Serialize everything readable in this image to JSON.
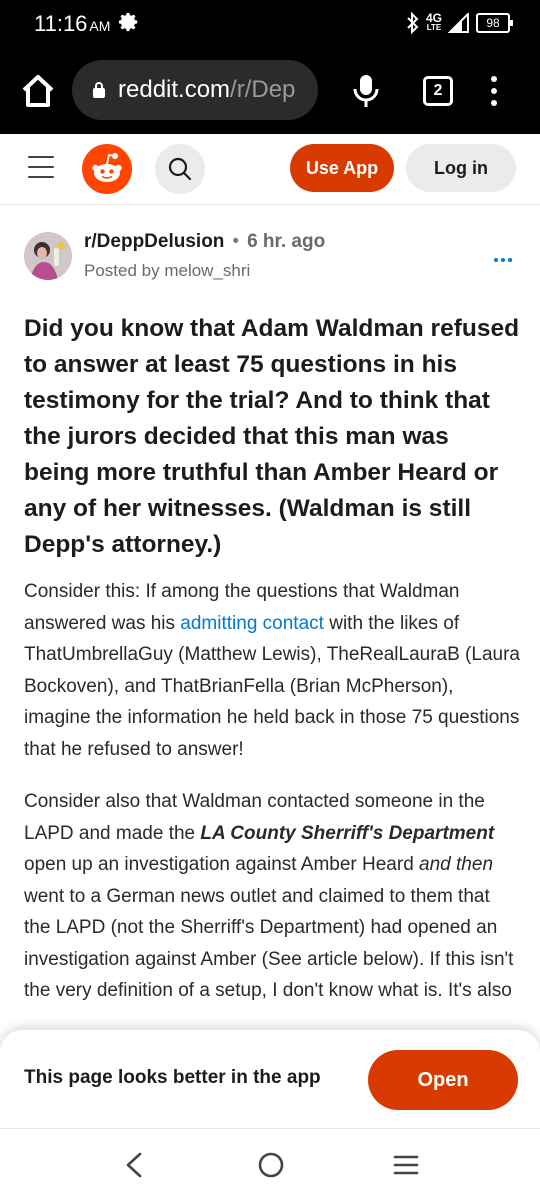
{
  "status_bar": {
    "time": "11:16",
    "ampm": "AM",
    "network": "4G",
    "network_sub": "LTE",
    "battery": "98",
    "icons": [
      "gear-icon",
      "bluetooth-icon",
      "signal-icon",
      "battery-icon"
    ]
  },
  "browser": {
    "url_host": "reddit.com",
    "url_path": "/r/Dep",
    "tab_count": "2",
    "icons": [
      "home-icon",
      "lock-icon",
      "microphone-icon",
      "tab-switcher-icon",
      "overflow-menu-icon"
    ]
  },
  "header": {
    "use_app_label": "Use App",
    "login_label": "Log in",
    "icons": [
      "hamburger-icon",
      "reddit-logo",
      "search-icon"
    ],
    "brand_color": "#D93A00"
  },
  "post": {
    "subreddit": "r/DeppDelusion",
    "separator": "•",
    "time_ago": "6 hr. ago",
    "posted_by": "Posted by melow_shri",
    "title": "Did you know that Adam Waldman refused to answer at least 75 questions in his testimony for the trial? And to think that the jurors decided that this man was being more truthful than Amber Heard or any of her witnesses. (Waldman is still Depp's attorney.)",
    "p1_before": "Consider this: If among the questions that Waldman answered was his ",
    "p1_link": "admitting contact",
    "p1_after": " with the likes of ThatUmbrellaGuy (Matthew Lewis), TheRealLauraB (Laura Bockoven), and ThatBrianFella (Brian McPherson), imagine the information he held back in those 75 questions that he refused to answer!",
    "p2_a": "Consider also that Waldman contacted someone in the LAPD and made the ",
    "p2_b": "LA County Sherriff's Department",
    "p2_c": " open up an investigation against Amber Heard ",
    "p2_d": "and then",
    "p2_e": " went to a German news outlet and claimed to them that the LAPD (not the Sherriff's Department) had opened an investigation against Amber (See article below). If this isn't the very definition of a setup, I don't know what is. It's also",
    "link_color": "#0079D3"
  },
  "banner": {
    "text": "This page looks better in the app",
    "open_label": "Open"
  },
  "nav": {
    "icons": [
      "back-icon",
      "home-circle-icon",
      "recents-icon"
    ]
  }
}
